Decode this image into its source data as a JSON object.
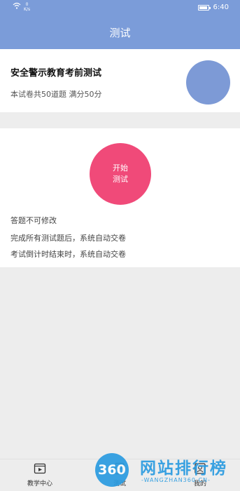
{
  "status_bar": {
    "speed_value": "0",
    "speed_unit": "K/s",
    "time": "6:40"
  },
  "header": {
    "title": "测试"
  },
  "exam_card": {
    "title": "安全警示教育考前测试",
    "info": "本试卷共50道题   满分50分"
  },
  "start": {
    "line1": "开始",
    "line2": "测试"
  },
  "rules": [
    "答题不可修改",
    "完成所有测试题后，系统自动交卷",
    "考试倒计时结束时，系统自动交卷"
  ],
  "tabs": [
    {
      "label": "教学中心",
      "icon": "video-icon"
    },
    {
      "label": "测试",
      "icon": "test-icon"
    },
    {
      "label": "我的",
      "icon": "user-icon"
    }
  ],
  "watermark": {
    "badge": "360",
    "title": "网站排行榜",
    "subtitle": "-WANGZHAN360.CN-"
  },
  "colors": {
    "header": "#7b9cd9",
    "start_button": "#f04a79",
    "avatar": "#7d9ad6",
    "watermark": "#2a9be0"
  }
}
